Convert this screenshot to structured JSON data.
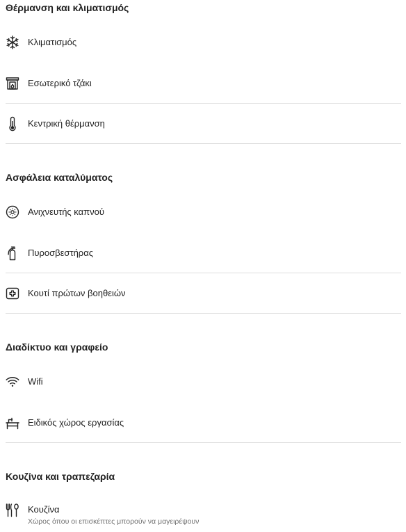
{
  "sections": [
    {
      "title": "Θέρμανση και κλιματισμός",
      "items": [
        {
          "label": "Κλιματισμός",
          "icon": "snowflake-icon"
        },
        {
          "label": "Εσωτερικό τζάκι",
          "icon": "fireplace-icon"
        },
        {
          "label": "Κεντρική θέρμανση",
          "icon": "thermometer-icon"
        }
      ]
    },
    {
      "title": "Ασφάλεια καταλύματος",
      "items": [
        {
          "label": "Ανιχνευτής καπνού",
          "icon": "smoke-detector-icon"
        },
        {
          "label": "Πυροσβεστήρας",
          "icon": "fire-extinguisher-icon"
        },
        {
          "label": "Κουτί πρώτων βοηθειών",
          "icon": "first-aid-kit-icon"
        }
      ]
    },
    {
      "title": "Διαδίκτυο και γραφείο",
      "items": [
        {
          "label": "Wifi",
          "icon": "wifi-icon"
        },
        {
          "label": "Ειδικός χώρος εργασίας",
          "icon": "workspace-desk-icon"
        }
      ]
    },
    {
      "title": "Κουζίνα και τραπεζαρία",
      "items": [
        {
          "label": "Κουζίνα",
          "sublabel": "Χώρος όπου οι επισκέπτες μπορούν να μαγειρέψουν",
          "icon": "kitchen-utensils-icon"
        }
      ]
    }
  ]
}
